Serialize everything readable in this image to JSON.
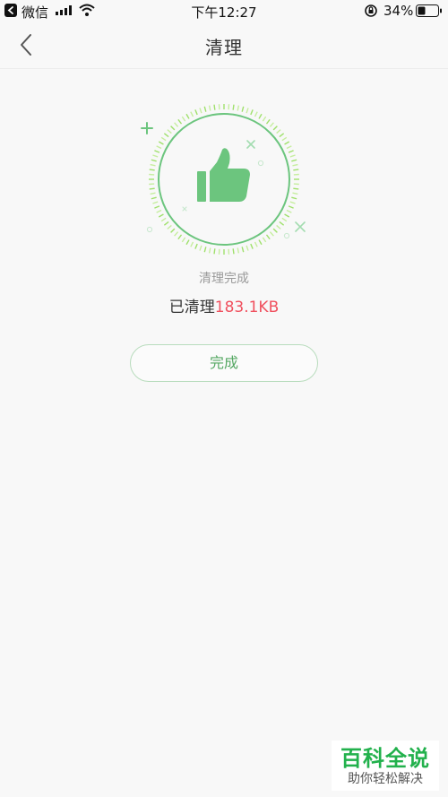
{
  "status_bar": {
    "app_name": "微信",
    "time": "下午12:27",
    "battery": "34%"
  },
  "header": {
    "title": "清理"
  },
  "result": {
    "status": "清理完成",
    "cleaned_prefix": "已清理",
    "cleaned_value": "183.1KB"
  },
  "actions": {
    "finish_label": "完成"
  },
  "watermark": {
    "title": "百科全说",
    "subtitle": "助你轻松解决"
  },
  "colors": {
    "accent_green": "#6cc57e",
    "value_red": "#f0505e"
  }
}
